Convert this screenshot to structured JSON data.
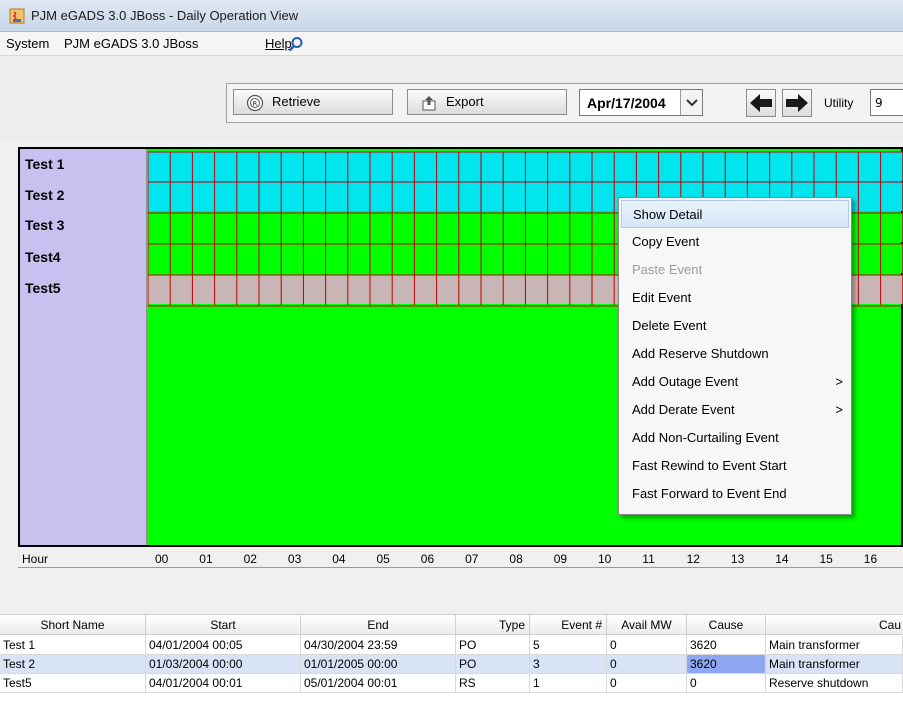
{
  "window": {
    "title": "PJM eGADS 3.0 JBoss - Daily Operation View"
  },
  "menu": {
    "items": [
      "System",
      "PJM eGADS 3.0 JBoss",
      "Help"
    ]
  },
  "toolbar": {
    "retrieve_label": "Retrieve",
    "export_label": "Export",
    "date_value": "Apr/17/2004",
    "utility_label": "Utility",
    "utility_value": "9"
  },
  "schedule": {
    "rows": [
      {
        "name": "Test 1",
        "color": "#00e5ee"
      },
      {
        "name": "Test 2",
        "color": "#00e5ee"
      },
      {
        "name": "Test 3",
        "color": "#00ff00"
      },
      {
        "name": "Test4",
        "color": "#00ff00"
      },
      {
        "name": "Test5",
        "color": "#c8b6b6"
      }
    ],
    "grid_line_color": "#c00000",
    "background_color": "#00ff00",
    "names_background": "#c7c1ef"
  },
  "hours": {
    "label": "Hour",
    "values": [
      "00",
      "01",
      "02",
      "03",
      "04",
      "05",
      "06",
      "07",
      "08",
      "09",
      "10",
      "11",
      "12",
      "13",
      "14",
      "15",
      "16"
    ]
  },
  "context_menu": {
    "items": [
      {
        "label": "Show Detail",
        "state": "highlighted"
      },
      {
        "label": "Copy Event",
        "state": "enabled"
      },
      {
        "label": "Paste Event",
        "state": "disabled"
      },
      {
        "label": "Edit Event",
        "state": "enabled"
      },
      {
        "label": "Delete Event",
        "state": "enabled"
      },
      {
        "label": "Add Reserve Shutdown",
        "state": "enabled"
      },
      {
        "label": "Add Outage Event",
        "state": "enabled",
        "submenu": true
      },
      {
        "label": "Add Derate Event",
        "state": "enabled",
        "submenu": true
      },
      {
        "label": "Add Non-Curtailing Event",
        "state": "enabled"
      },
      {
        "label": "Fast Rewind to Event Start",
        "state": "enabled"
      },
      {
        "label": "Fast Forward to Event End",
        "state": "enabled"
      }
    ],
    "submenu_arrow": ">"
  },
  "table": {
    "columns": [
      "Short Name",
      "Start",
      "End",
      "Type",
      "Event #",
      "Avail MW",
      "Cause",
      "Cau"
    ],
    "rows": [
      [
        "Test 1",
        "04/01/2004 00:05",
        "04/30/2004 23:59",
        "PO",
        "5",
        "0",
        "3620",
        "Main transformer"
      ],
      [
        "Test 2",
        "01/03/2004 00:00",
        "01/01/2005 00:00",
        "PO",
        "3",
        "0",
        "3620",
        "Main transformer"
      ],
      [
        "Test5",
        "04/01/2004 00:01",
        "05/01/2004 00:01",
        "RS",
        "1",
        "0",
        "0",
        "Reserve shutdown"
      ]
    ],
    "selected_row": 1
  }
}
